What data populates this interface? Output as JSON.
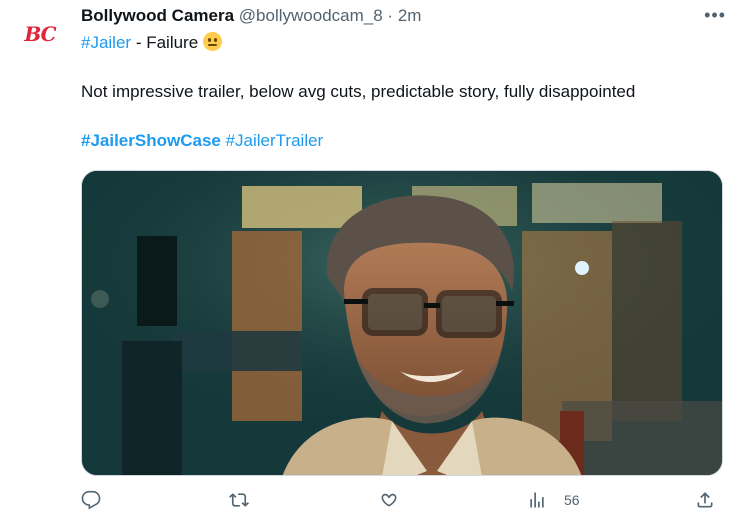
{
  "author": {
    "avatar_text": "BC",
    "name": "Bollywood Camera",
    "handle": "@bollywoodcam_8",
    "separator": "·",
    "time": "2m"
  },
  "tweet": {
    "hashtag1": "#Jailer",
    "line1_rest": " - Failure",
    "emoji": "neutral-face",
    "body": "Not impressive trailer, below avg cuts, predictable story, fully disappointed",
    "hashtag2": "#JailerShowCase",
    "hashtag3": "#JailerTrailer"
  },
  "stats": {
    "views": "56"
  },
  "colors": {
    "accent": "#1d9bf0",
    "text": "#0f1419",
    "muted": "#536471",
    "avatar_text": "#e0243a"
  },
  "icons": {
    "reply": "reply-icon",
    "retweet": "retweet-icon",
    "like": "heart-icon",
    "views": "analytics-icon",
    "share": "share-icon",
    "more": "more-icon"
  }
}
